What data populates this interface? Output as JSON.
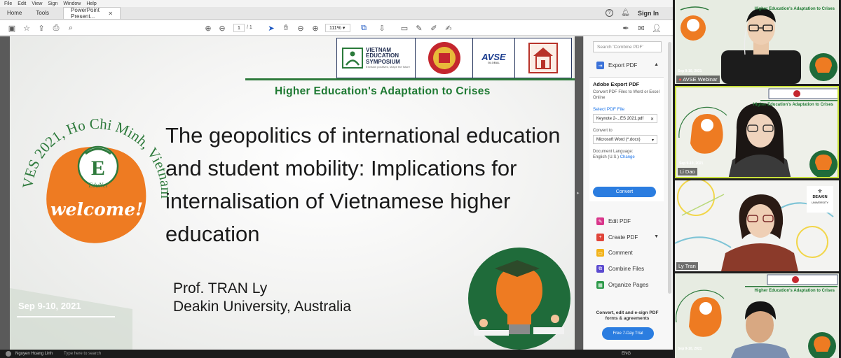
{
  "menu": [
    "File",
    "Edit",
    "View",
    "Sign",
    "Window",
    "Help"
  ],
  "tabs": {
    "home": "Home",
    "tools": "Tools",
    "document": "PowerPoint Present...",
    "sign_in": "Sign In"
  },
  "toolbar": {
    "page_current": "1",
    "page_total": "/ 1",
    "zoom": "111%"
  },
  "slide": {
    "title": "The geopolitics of international education and student mobility: Implications for internalisation of Vietnamese higher education",
    "speaker_name": "Prof. TRAN Ly",
    "speaker_affiliation": "Deakin University, Australia",
    "header": "Higher Education's Adaptation to Crises",
    "event_arc": "VES 2021, Ho Chi Minh, Vietnam",
    "welcome": "welcome!",
    "edunet": "EduNet",
    "date": "Sep 9-10, 2021",
    "logo_ves_line1": "VIETNAM",
    "logo_ves_line2": "EDUCATION",
    "logo_ves_line3": "SYMPOSIUM",
    "logo_ves_tagline": "Envision positives, shape the future",
    "logo_avse": "AVSE",
    "logo_avse_sub": "GLOBAL"
  },
  "panel": {
    "search_placeholder": "Search 'Combine PDF'",
    "export_pdf": "Export PDF",
    "card_heading": "Adobe Export PDF",
    "card_desc": "Convert PDF Files to Word or Excel Online",
    "select_pdf": "Select PDF File",
    "file_name": "Keynote 2-...ES 2021.pdf",
    "convert_to_label": "Convert to",
    "convert_to_value": "Microsoft Word (*.docx)",
    "doc_language_label": "Document Language:",
    "doc_language_value": "English (U.S.)",
    "change": "Change",
    "convert_button": "Convert",
    "tools": [
      "Edit PDF",
      "Create PDF",
      "Comment",
      "Combine Files",
      "Organize Pages"
    ],
    "footer": "Convert, edit and e-sign PDF forms & agreements",
    "trial_button": "Free 7-Day Trial"
  },
  "taskbar": {
    "user": "Nguyen Hoang Linh",
    "search": "Type here to search",
    "lang": "ENG"
  },
  "participants": [
    {
      "name": "AVSE Webinar"
    },
    {
      "name": "Li Dao"
    },
    {
      "name": "Ly Tran"
    },
    {
      "name": ""
    }
  ],
  "tile_header": "Higher Education's Adaptation to Crises",
  "tile_date": "Sep 9-10, 2021",
  "tile_event_arc": "VES 2021, Ho Chi Minh, Vietnam",
  "tile_welcome": "welcome!",
  "deakin_logo": "DEAKIN",
  "deakin_sub": "UNIVERSITY",
  "colors": {
    "accent_green": "#1f7a33",
    "orange": "#ee7b22",
    "adobe_blue": "#2b7de0",
    "red": "#e8352b"
  }
}
